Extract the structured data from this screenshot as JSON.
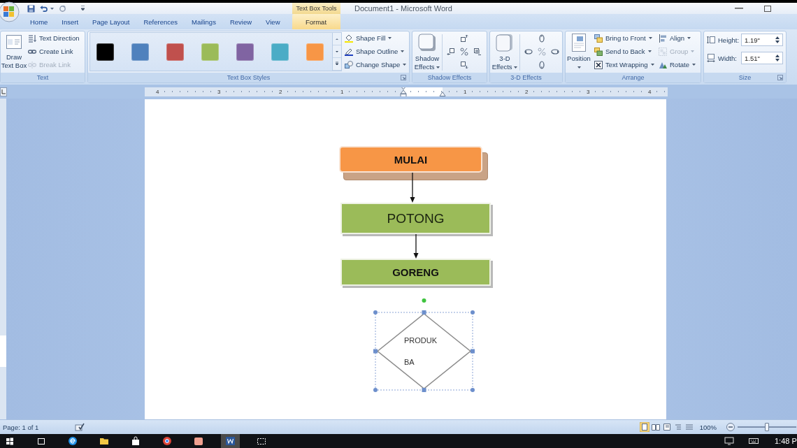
{
  "title_bar": {
    "context_tab": "Text Box Tools",
    "title": "Document1 - Microsoft Word"
  },
  "tabs": [
    {
      "label": "Home",
      "selected": false
    },
    {
      "label": "Insert",
      "selected": false
    },
    {
      "label": "Page Layout",
      "selected": false
    },
    {
      "label": "References",
      "selected": false
    },
    {
      "label": "Mailings",
      "selected": false
    },
    {
      "label": "Review",
      "selected": false
    },
    {
      "label": "View",
      "selected": false
    },
    {
      "label": "Format",
      "selected": true
    }
  ],
  "ribbon": {
    "text_group": {
      "label": "Text",
      "draw_text_box": "Draw Text Box",
      "commands": [
        {
          "label": "Text Direction",
          "disabled": false
        },
        {
          "label": "Create Link",
          "disabled": false
        },
        {
          "label": "Break Link",
          "disabled": true
        }
      ]
    },
    "styles_group": {
      "label": "Text Box Styles",
      "swatches": [
        {
          "color": "#000000"
        },
        {
          "color": "#4f81bd"
        },
        {
          "color": "#c0504d"
        },
        {
          "color": "#9bbb59"
        },
        {
          "color": "#8064a2"
        },
        {
          "color": "#4bacc6"
        },
        {
          "color": "#f79646"
        }
      ],
      "commands": [
        {
          "label": "Shape Fill",
          "dropdown": true,
          "disabled": false
        },
        {
          "label": "Shape Outline",
          "dropdown": true,
          "disabled": false
        },
        {
          "label": "Change Shape",
          "dropdown": true,
          "disabled": false
        }
      ]
    },
    "shadow_group": {
      "label": "Shadow Effects",
      "button": "Shadow Effects"
    },
    "effects_3d_group": {
      "label": "3-D Effects",
      "button": "3-D Effects"
    },
    "arrange_group": {
      "label": "Arrange",
      "position": "Position",
      "commands": [
        {
          "label": "Bring to Front",
          "dropdown": true,
          "disabled": false
        },
        {
          "label": "Send to Back",
          "dropdown": true,
          "disabled": false
        },
        {
          "label": "Text Wrapping",
          "dropdown": true,
          "disabled": false
        },
        {
          "label": "Align",
          "dropdown": true,
          "disabled": false
        },
        {
          "label": "Group",
          "dropdown": true,
          "disabled": true
        },
        {
          "label": "Rotate",
          "dropdown": true,
          "disabled": false
        }
      ]
    },
    "size_group": {
      "label": "Size",
      "fields": [
        {
          "label": "Height:",
          "value": "1.19\""
        },
        {
          "label": "Width:",
          "value": "1.51\""
        }
      ]
    }
  },
  "ruler": {
    "left_numbers": [
      "4",
      "3",
      "2",
      "1"
    ],
    "right_numbers": [
      "1",
      "2",
      "3",
      "4"
    ]
  },
  "document": {
    "shapes": [
      {
        "kind": "terminator",
        "label": "MULAI",
        "bold": true,
        "color": "#f79646",
        "arrow_to_next": true,
        "selected": false
      },
      {
        "kind": "process",
        "label": "POTONG",
        "bold": false,
        "color": "#9bbb59",
        "arrow_to_next": true,
        "selected": false
      },
      {
        "kind": "process",
        "label": "GORENG",
        "bold": true,
        "color": "#9bbb59",
        "arrow_to_next": false,
        "selected": false
      },
      {
        "kind": "decision",
        "label": "PRODUK BA",
        "bold": false,
        "arrow_to_next": false,
        "selected": true
      }
    ]
  },
  "status_bar": {
    "page": "Page: 1 of 1",
    "views": [
      {
        "selected": true
      },
      {
        "selected": false
      },
      {
        "selected": false
      },
      {
        "selected": false
      },
      {
        "selected": false
      }
    ],
    "zoom": {
      "reading": "100%",
      "level": 0.5
    }
  },
  "taskbar": {
    "apps": [
      {
        "selected": false
      },
      {
        "selected": false
      },
      {
        "selected": false
      },
      {
        "selected": false
      },
      {
        "selected": false
      },
      {
        "selected": false
      },
      {
        "selected": false
      },
      {
        "selected": true
      },
      {
        "selected": false
      }
    ],
    "clock": "1:48 P"
  }
}
